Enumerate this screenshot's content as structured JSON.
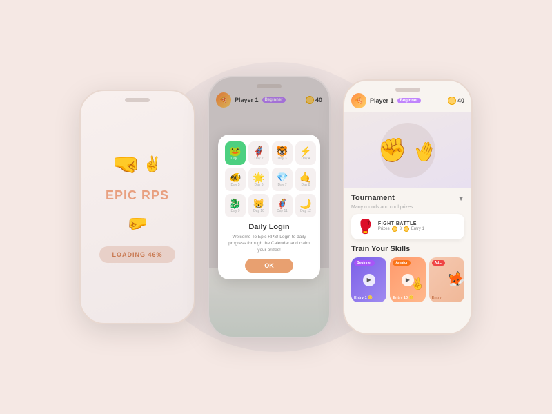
{
  "background": "#f5e8e4",
  "phone1": {
    "title": "EPIC RPS",
    "loading_text": "LOADING 46%",
    "top_hand": "✊",
    "bottom_hand": "✌️"
  },
  "phone2": {
    "player_name": "Player 1",
    "badge": "Beginner",
    "coins": "40",
    "modal": {
      "title": "Daily Login",
      "description": "Welcome To Epic RPS! Login to daily progress through the Calendar and claim your prizes!",
      "ok_button": "OK",
      "days": [
        {
          "label": "Day 1",
          "icon": "🐸",
          "active": true
        },
        {
          "label": "Day 2",
          "icon": "🦸",
          "active": false
        },
        {
          "label": "Day 3",
          "icon": "🐯",
          "active": false
        },
        {
          "label": "Day 4",
          "icon": "⚡",
          "active": false
        },
        {
          "label": "Day 5",
          "icon": "🐠",
          "active": false
        },
        {
          "label": "Day 6",
          "icon": "🌟",
          "active": false
        },
        {
          "label": "Day 7",
          "icon": "💎",
          "active": false
        },
        {
          "label": "Day 8",
          "icon": "🤙",
          "active": false
        },
        {
          "label": "Day 9",
          "icon": "🐉",
          "active": false
        },
        {
          "label": "Day 10",
          "icon": "😸",
          "active": false
        },
        {
          "label": "Day 11",
          "icon": "🦸",
          "active": false
        },
        {
          "label": "Day 12",
          "icon": "🌙",
          "active": false
        }
      ]
    }
  },
  "phone3": {
    "player_name": "Player 1",
    "badge": "Beginner",
    "coins": "40",
    "tournament": {
      "section_title": "Tournament",
      "section_sub": "Many rounds and cool prizes",
      "name": "FIGHT BATTLE",
      "prizes_label": "Prizes",
      "prizes_value": "3",
      "entry_label": "Entry 1"
    },
    "train": {
      "section_title": "Train Your Skills",
      "cards": [
        {
          "badge": "Beginner",
          "entry": "Entry 1"
        },
        {
          "badge": "Amator",
          "entry": "Entry 10"
        },
        {
          "badge": "Ad...",
          "entry": "Entry"
        }
      ]
    }
  }
}
